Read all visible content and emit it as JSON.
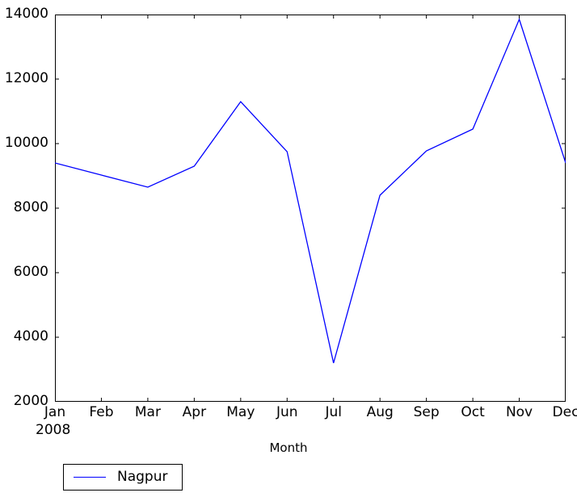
{
  "figure": {
    "background": "#ffffff"
  },
  "chart_data": {
    "type": "line",
    "title": "",
    "xlabel": "Month",
    "ylabel": "",
    "x_offset_label": "2008",
    "categories": [
      "Jan",
      "Feb",
      "Mar",
      "Apr",
      "May",
      "Jun",
      "Jul",
      "Aug",
      "Sep",
      "Oct",
      "Nov",
      "Dec"
    ],
    "series": [
      {
        "name": "Nagpur",
        "color": "#0000ff",
        "values": [
          9400,
          9025,
          8650,
          9300,
          11300,
          9750,
          3200,
          8400,
          9775,
          10450,
          13850,
          9400
        ]
      }
    ],
    "ylim": [
      2000,
      14000
    ],
    "yticks": [
      2000,
      4000,
      6000,
      8000,
      10000,
      12000,
      14000
    ],
    "ytick_labels": [
      "2000",
      "4000",
      "6000",
      "8000",
      "10000",
      "12000",
      "14000"
    ],
    "xticks": [
      0,
      1,
      2,
      3,
      4,
      5,
      6,
      7,
      8,
      9,
      10,
      11
    ],
    "grid": false,
    "legend": {
      "position": "below-left",
      "entries": [
        {
          "label": "Nagpur",
          "color": "#0000ff"
        }
      ]
    }
  }
}
